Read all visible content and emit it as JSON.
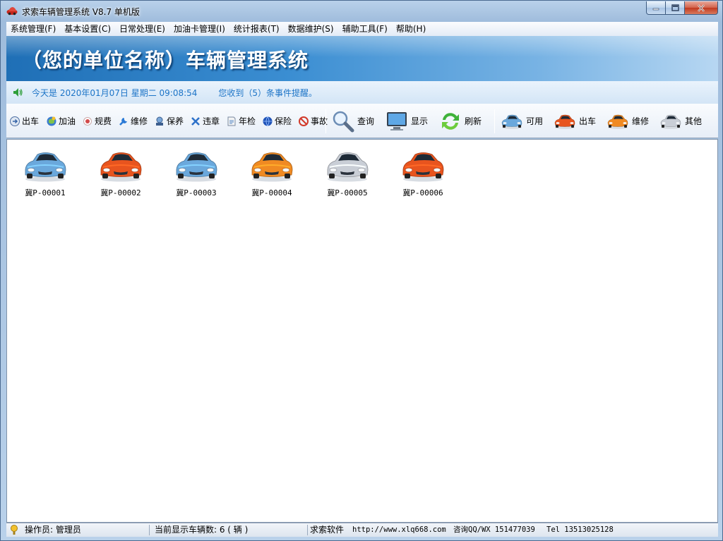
{
  "window": {
    "title": "求索车辆管理系统 V8.7 单机版"
  },
  "menu": [
    {
      "label": "系统管理(F)"
    },
    {
      "label": "基本设置(C)"
    },
    {
      "label": "日常处理(E)"
    },
    {
      "label": "加油卡管理(I)"
    },
    {
      "label": "统计报表(T)"
    },
    {
      "label": "数据维护(S)"
    },
    {
      "label": "辅助工具(F)"
    },
    {
      "label": "帮助(H)"
    }
  ],
  "banner": {
    "title": "（您的单位名称）车辆管理系统"
  },
  "info": {
    "date_text": "今天是 2020年01月07日 星期二 09:08:54",
    "alert_text": "您收到（5）条事件提醒。"
  },
  "toolbar": {
    "small": [
      {
        "label": "出车",
        "icon": "car-out-icon"
      },
      {
        "label": "加油",
        "icon": "fuel-icon"
      },
      {
        "label": "规费",
        "icon": "fee-icon"
      },
      {
        "label": "维修",
        "icon": "wrench-icon"
      },
      {
        "label": "保养",
        "icon": "maintenance-icon"
      },
      {
        "label": "违章",
        "icon": "violation-icon"
      },
      {
        "label": "年检",
        "icon": "inspection-icon"
      },
      {
        "label": "保险",
        "icon": "insurance-icon"
      },
      {
        "label": "事故",
        "icon": "accident-icon"
      }
    ],
    "big": [
      {
        "label": "查询",
        "icon": "magnifier-icon"
      },
      {
        "label": "显示",
        "icon": "monitor-icon"
      },
      {
        "label": "刷新",
        "icon": "refresh-icon"
      }
    ],
    "legend": [
      {
        "label": "可用",
        "color": "#6aa8dc"
      },
      {
        "label": "出车",
        "color": "#e8541e"
      },
      {
        "label": "维修",
        "color": "#f08a22"
      },
      {
        "label": "其他",
        "color": "#c9ced6"
      }
    ]
  },
  "vehicles": [
    {
      "plate": "冀P-00001",
      "color": "#6aa8dc"
    },
    {
      "plate": "冀P-00002",
      "color": "#e8541e"
    },
    {
      "plate": "冀P-00003",
      "color": "#6aa8dc"
    },
    {
      "plate": "冀P-00004",
      "color": "#f08a22"
    },
    {
      "plate": "冀P-00005",
      "color": "#c9ced6"
    },
    {
      "plate": "冀P-00006",
      "color": "#e8541e"
    }
  ],
  "status": {
    "operator": "操作员: 管理员",
    "vehicle_count": "当前显示车辆数: 6 ( 辆 )",
    "vendor": "求索软件",
    "url": "http://www.xlq668.com",
    "qq": "咨询QQ/WX 151477039",
    "tel": "Tel 13513025128"
  }
}
